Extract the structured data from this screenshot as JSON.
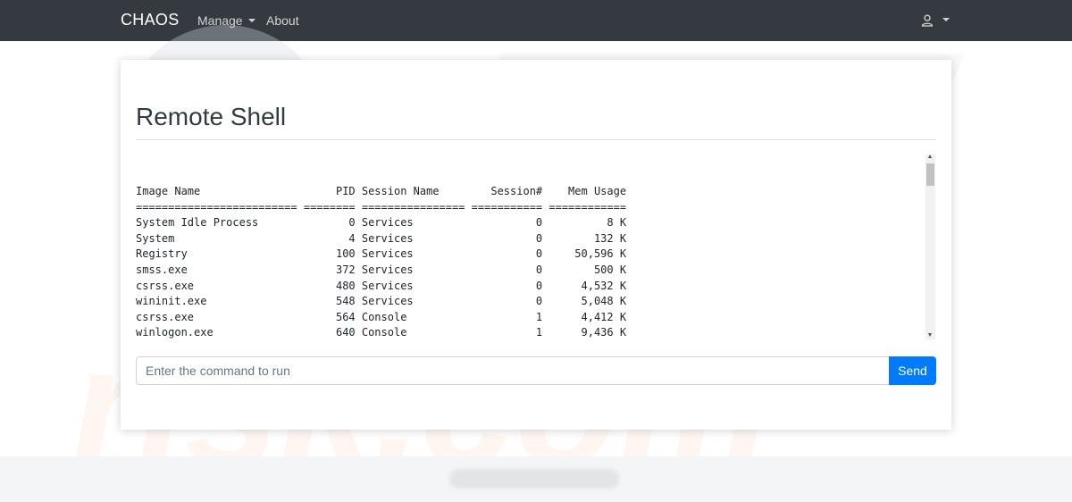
{
  "navbar": {
    "brand": "CHAOS",
    "manage_label": "Manage",
    "about_label": "About",
    "user_icon": "user-icon"
  },
  "main": {
    "title": "Remote Shell",
    "output": "Image Name                     PID Session Name        Session#    Mem Usage\n========================= ======== ================ =========== ============\nSystem Idle Process              0 Services                   0          8 K\nSystem                           4 Services                   0        132 K\nRegistry                       100 Services                   0     50,596 K\nsmss.exe                       372 Services                   0        500 K\ncsrss.exe                      480 Services                   0      4,532 K\nwininit.exe                    548 Services                   0      5,048 K\ncsrss.exe                      564 Console                    1      4,412 K\nwinlogon.exe                   640 Console                    1      9,436 K",
    "command_placeholder": "Enter the command to run",
    "command_value": "",
    "send_label": "Send"
  },
  "colors": {
    "navbar_bg": "#343a40",
    "primary": "#007bff"
  }
}
